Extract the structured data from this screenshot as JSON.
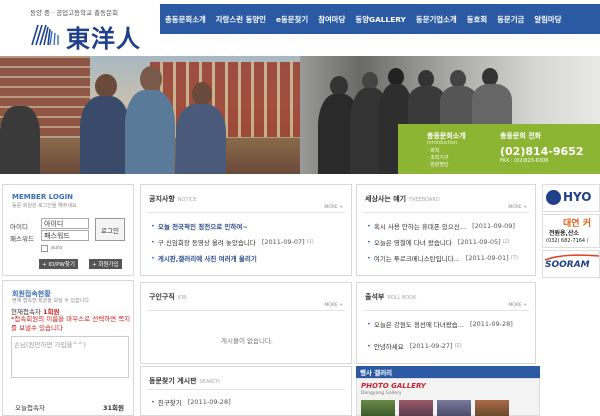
{
  "header": {
    "tagline": "동양 중 · 공업고등학교 총동문회",
    "logo_text": "東洋人",
    "nav": [
      "총동문회소개",
      "자랑스런 동양인",
      "e동문찾기",
      "참여마당",
      "동양GALLERY",
      "동문기업소개",
      "동호회",
      "동문기금",
      "알림마당"
    ]
  },
  "banner": {
    "intro_title": "총동문회소개",
    "intro_sub": "Introduction",
    "intro_links": [
      "회칙",
      "조직기구",
      "임원명단"
    ],
    "contact_title": "총동문회 전화",
    "phone": "(02)814-9652",
    "fax": "FAX : (02)823-6306"
  },
  "login": {
    "title": "MEMBER LOGIN",
    "subtitle": "동문 회원은 로그인을 해주세요",
    "id_label": "아이디",
    "pw_label": "패스워드",
    "id_value": "아이디",
    "pw_value": "패스워드",
    "login_button": "로그인",
    "auto_label": "auto",
    "find_button": "+ ID/PW찾기",
    "join_button": "+ 회원가입"
  },
  "users": {
    "title": "회원접속현황",
    "subtitle": "현재 접속한 회원을 보실 수 있습니다.",
    "now_label": "현재접속자",
    "now_count": "1회원",
    "notice": "*접속회원의 이름을 마우스로 선택하면 쪽지를 보낼수 있습니다",
    "message_placeholder": "손님(원만하면 가입을^^)",
    "today_label": "오늘접속자",
    "today_count": "31회원"
  },
  "boards": {
    "notice": {
      "title": "공지사항",
      "title_en": "NOTICE",
      "more": "MORE +",
      "rows": [
        {
          "text": "오늘 전국적인 정전으로 인하여~",
          "date": "",
          "count": ""
        },
        {
          "text": "구.신임회장 동영상 올려 놓았습니다",
          "date": "[2011-09-07]",
          "count": "(1)"
        },
        {
          "text": "게시판,갤러리에 사진 여러개 올리기",
          "date": "",
          "count": ""
        }
      ]
    },
    "free": {
      "title": "세상사는 얘기",
      "title_en": "FREEBOARD",
      "more": "MORE +",
      "rows": [
        {
          "text": "혹시 사용 안하는 휴대폰 있으신...",
          "date": "[2011-09-09]",
          "count": ""
        },
        {
          "text": "오늘은 영철에 다녀 왔습니다",
          "date": "[2011-09-05]",
          "count": "(2)"
        },
        {
          "text": "여기는 투르크메니스탄입니다...",
          "date": "[2011-09-01]",
          "count": "(7)"
        }
      ]
    },
    "jobs": {
      "title": "구인구직",
      "title_en": "JOB",
      "more": "MORE +",
      "empty": "게시물이 없습니다."
    },
    "roll": {
      "title": "출석부",
      "title_en": "ROLL BOOK",
      "more": "MORE +",
      "rows": [
        {
          "text": "오늘은 강원도 정선에 다녀왔습...",
          "date": "[2011-09-28]",
          "count": ""
        },
        {
          "text": "안녕하세요",
          "date": "[2011-09-27]",
          "count": "(2)"
        }
      ]
    },
    "finder": {
      "title": "동문찾기 게시판",
      "title_en": "SEARCH",
      "rows": [
        {
          "text": "친구찾기",
          "date": "[2011-09-28]",
          "count": ""
        }
      ]
    }
  },
  "gallery": {
    "heading": "행사 갤러리",
    "title": "PHOTO GALLERY",
    "subtitle": "Dongyang Gallery"
  },
  "ads": {
    "hyo": "HYO",
    "daeyeon_title": "대연 커",
    "daeyeon_sub": "전원용,산소",
    "daeyeon_tel": "(032) 682-7164 /",
    "sooram": "SOORAM"
  },
  "colors": {
    "nav_bg": "#2b5aa3",
    "accent_green": "#8db533",
    "title_blue": "#3a6fb8",
    "alert_red": "#cc2222"
  }
}
